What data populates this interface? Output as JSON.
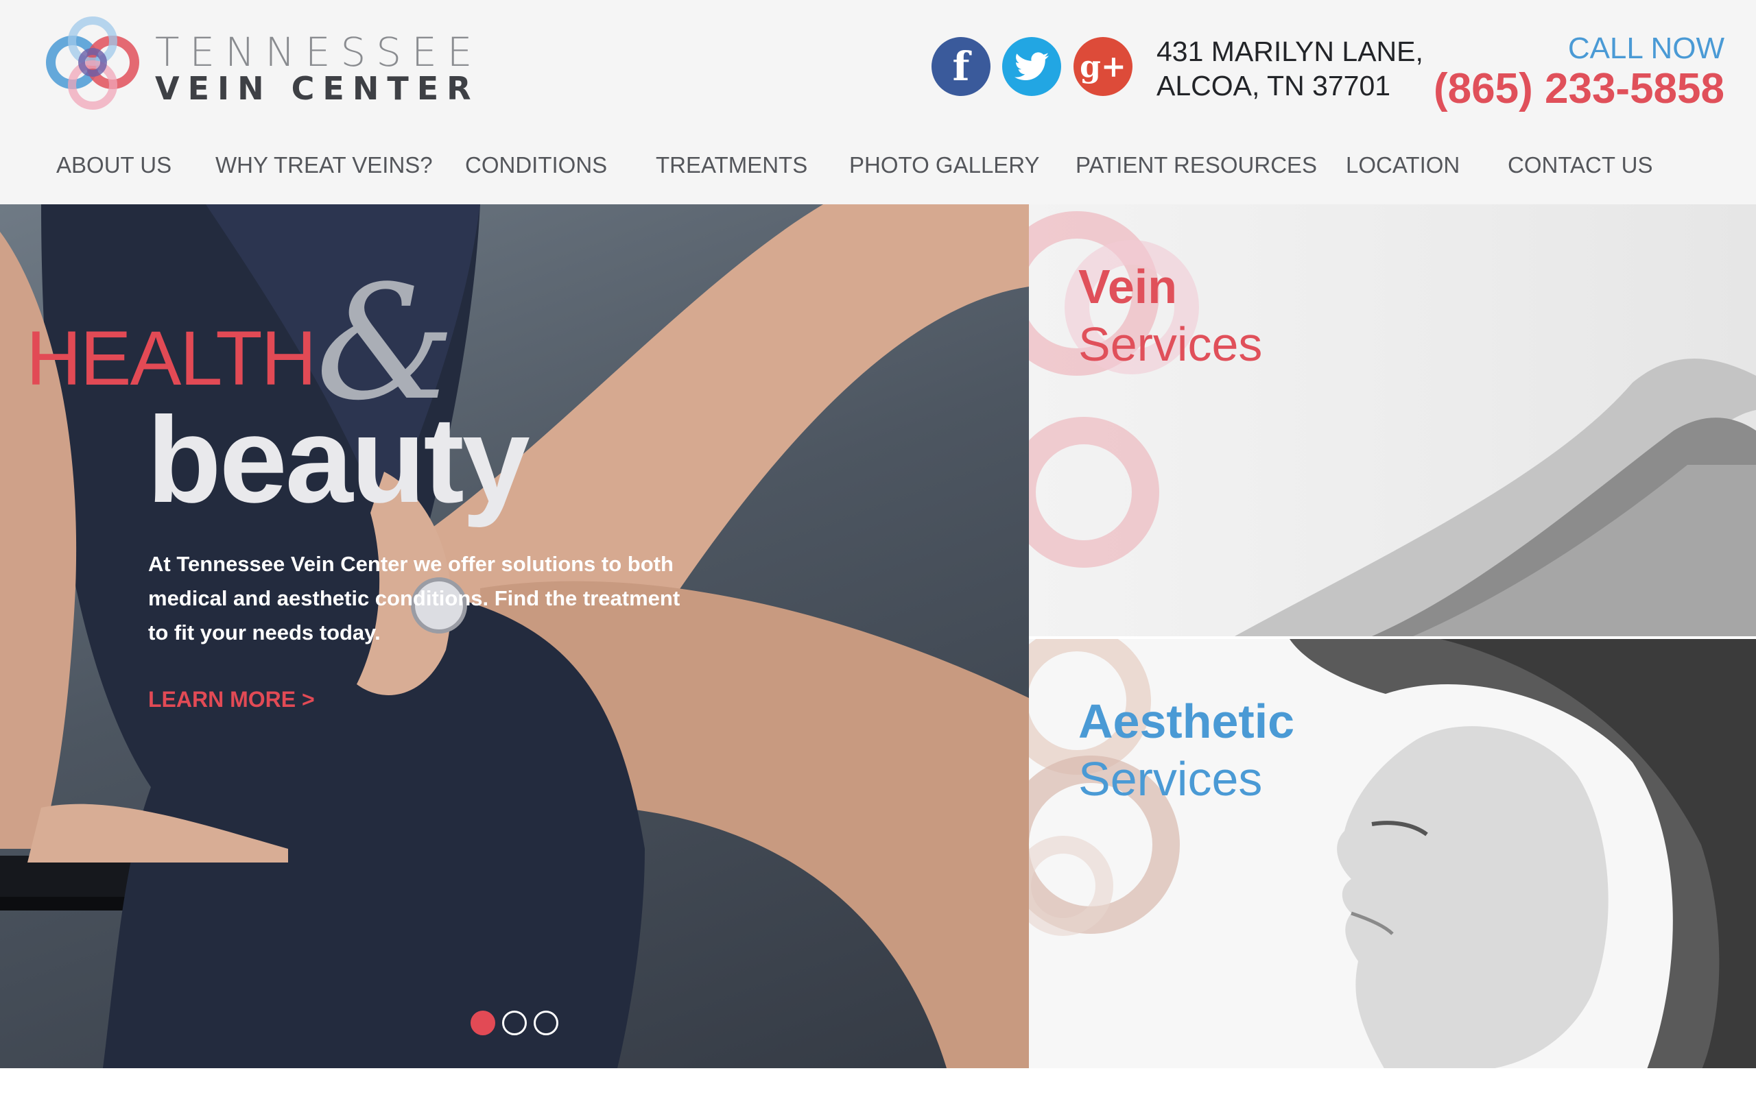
{
  "brand": {
    "name_top": "TENNESSEE",
    "name_bottom": "VEIN CENTER"
  },
  "social": [
    {
      "icon": "facebook-icon",
      "glyph": "f"
    },
    {
      "icon": "twitter-icon",
      "glyph": ""
    },
    {
      "icon": "google-plus-icon",
      "glyph": "g+"
    }
  ],
  "address": {
    "line1": "431 MARILYN LANE,",
    "line2": "ALCOA, TN 37701"
  },
  "call": {
    "label": "CALL NOW",
    "phone": "(865) 233-5858"
  },
  "nav": [
    {
      "label": "ABOUT US"
    },
    {
      "label": "WHY TREAT VEINS?"
    },
    {
      "label": "CONDITIONS"
    },
    {
      "label": "TREATMENTS"
    },
    {
      "label": "PHOTO GALLERY"
    },
    {
      "label": "PATIENT RESOURCES"
    },
    {
      "label": "LOCATION"
    },
    {
      "label": "CONTACT US"
    }
  ],
  "hero": {
    "word1": "HEALTH",
    "amp": "&",
    "word2": "beauty",
    "description": "At Tennessee Vein Center we offer solutions to both medical and aesthetic conditions. Find the treatment to fit your needs today.",
    "cta": "LEARN MORE >",
    "slides": 3,
    "active_slide": 1
  },
  "panels": {
    "vein": {
      "line1": "Vein",
      "line2": "Services"
    },
    "aesthetic": {
      "line1": "Aesthetic",
      "line2": "Services"
    }
  },
  "colors": {
    "accent_red": "#e0505a",
    "accent_blue": "#4a9ad5",
    "facebook": "#3a5a9b",
    "twitter": "#22a6e3",
    "google_plus": "#dd4b39"
  }
}
